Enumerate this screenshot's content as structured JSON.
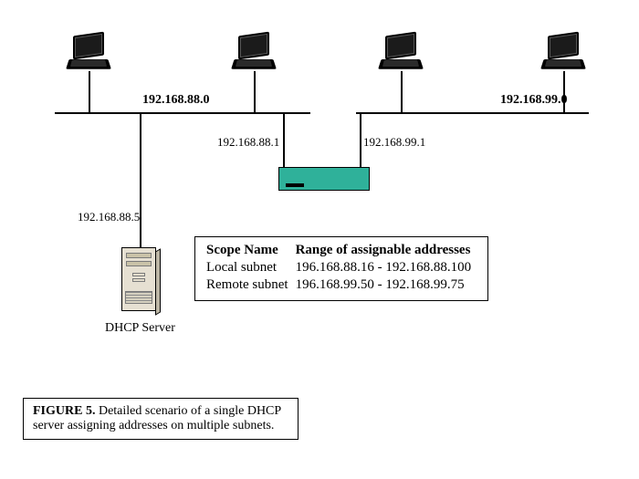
{
  "subnets": {
    "left": {
      "cidr": "192.168.88.0",
      "gateway_label": "192.168.88.1",
      "server_ip_label": "192.168.88.5"
    },
    "right": {
      "cidr": "192.168.99.0",
      "gateway_label": "192.168.99.1"
    }
  },
  "server": {
    "caption": "DHCP Server"
  },
  "scope_table": {
    "headers": {
      "name": "Scope Name",
      "range": "Range of assignable addresses"
    },
    "rows": [
      {
        "name": "Local subnet",
        "range": "196.168.88.16 - 192.168.88.100"
      },
      {
        "name": "Remote subnet",
        "range": "196.168.99.50 - 192.168.99.75"
      }
    ]
  },
  "figure": {
    "label": "FIGURE 5.",
    "text": " Detailed scenario of a single DHCP server assigning addresses on multiple subnets."
  },
  "icons": {
    "laptop": "laptop-icon",
    "router": "router-icon",
    "server": "server-tower-icon"
  }
}
